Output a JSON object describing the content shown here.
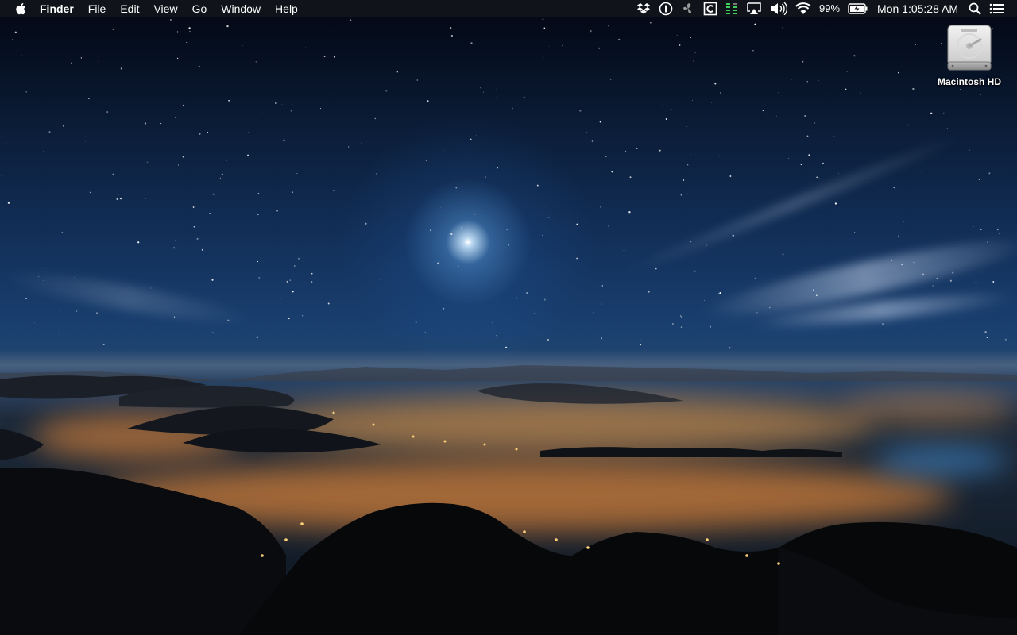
{
  "menubar": {
    "apple_icon": "apple-logo-icon",
    "app_name": "Finder",
    "menus": [
      "File",
      "Edit",
      "View",
      "Go",
      "Window",
      "Help"
    ],
    "status_icons": [
      "dropbox-icon",
      "1password-icon",
      "fan-icon",
      "clipboard-c-icon",
      "activity-bars-icon",
      "airplay-icon",
      "volume-icon",
      "wifi-icon"
    ],
    "battery_percent": "99%",
    "battery_icon": "battery-charging-icon",
    "clock": "Mon 1:05:28 AM",
    "search_icon": "spotlight-search-icon",
    "notification_icon": "notification-center-icon"
  },
  "desktop": {
    "icons": [
      {
        "label": "Macintosh HD",
        "icon": "hard-drive-icon"
      }
    ]
  },
  "colors": {
    "menubar_bg": "#16181c",
    "sky_top": "#020611",
    "sky_mid": "#1a4070",
    "city_glow": "#ffb05a"
  }
}
